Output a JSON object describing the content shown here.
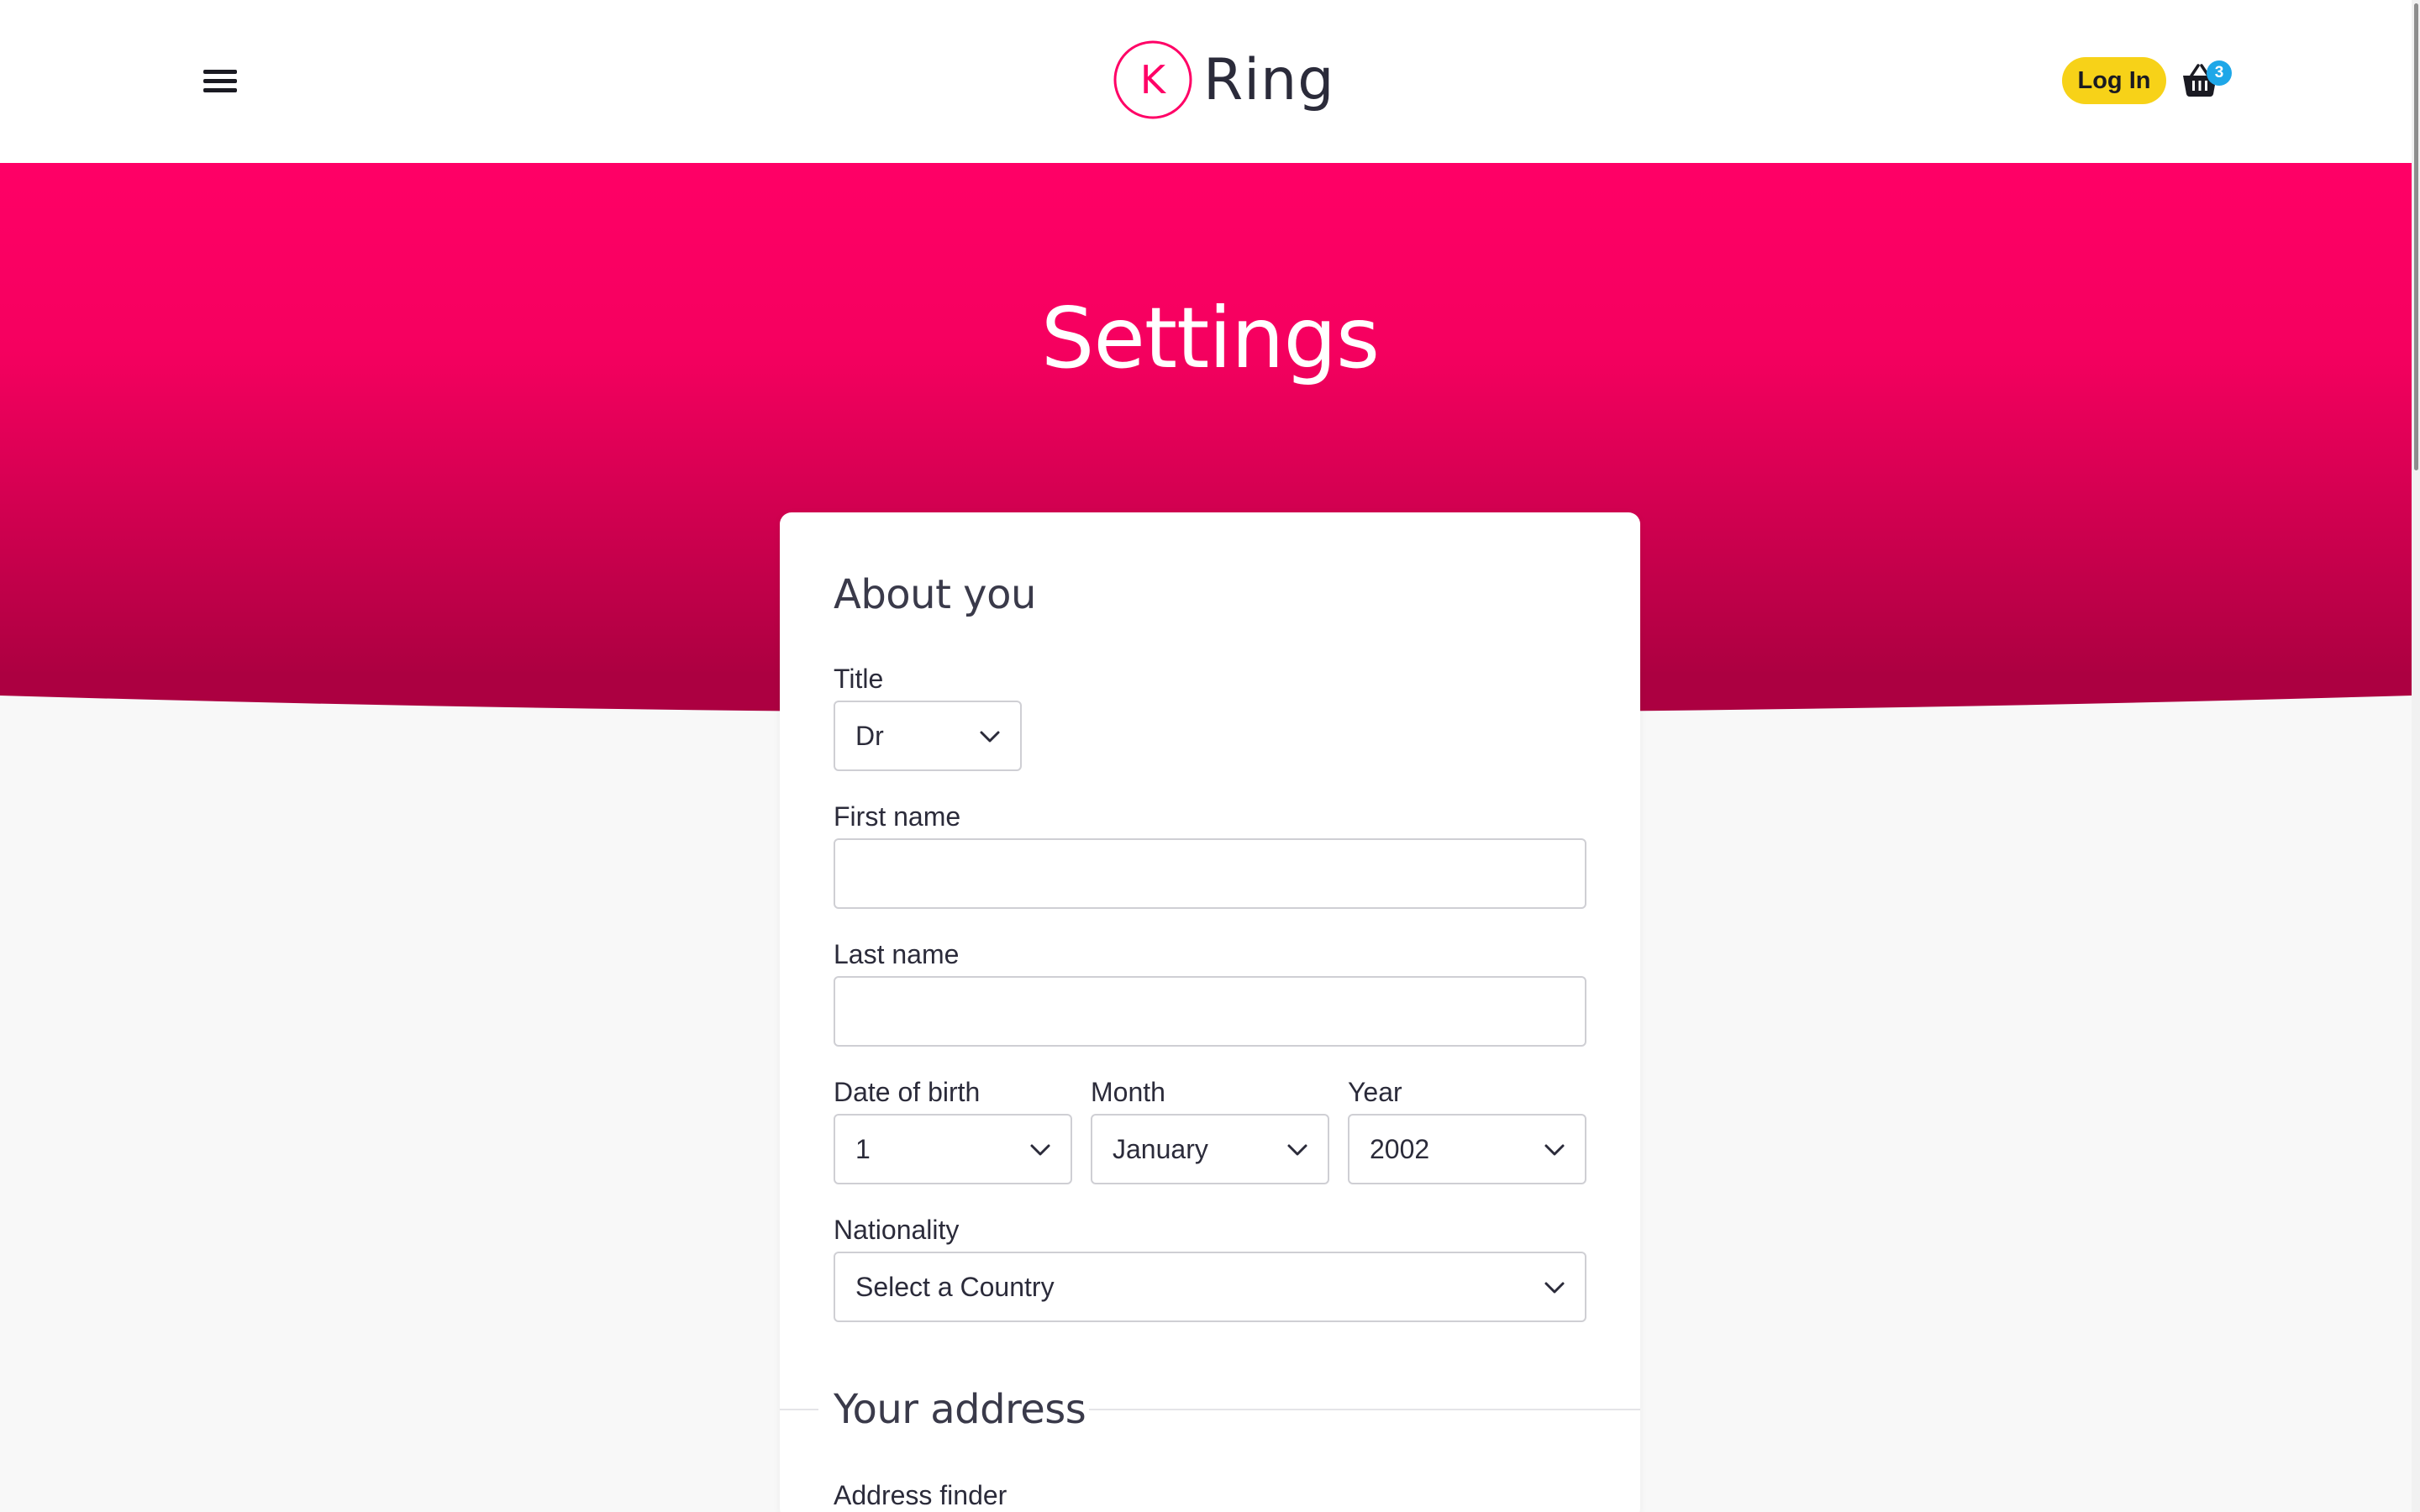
{
  "header": {
    "logo_letter": "K",
    "logo_text": "Ring",
    "login_label": "Log In",
    "basket_count": "3"
  },
  "hero": {
    "title": "Settings"
  },
  "form": {
    "about_title": "About you",
    "title_label": "Title",
    "title_value": "Dr",
    "first_name_label": "First name",
    "first_name_value": "",
    "last_name_label": "Last name",
    "last_name_value": "",
    "dob_label": "Date of birth",
    "dob_day_value": "1",
    "month_label": "Month",
    "month_value": "January",
    "year_label": "Year",
    "year_value": "2002",
    "nationality_label": "Nationality",
    "nationality_value": "Select a Country",
    "address_title": "Your address",
    "address_finder_label": "Address finder"
  },
  "colors": {
    "brand_pink": "#ff0066",
    "brand_pink_dark": "#a8003f",
    "login_yellow": "#f7d218",
    "badge_blue": "#1ea7e8"
  },
  "icons": [
    "menu-icon",
    "basket-icon",
    "chevron-down-icon"
  ]
}
